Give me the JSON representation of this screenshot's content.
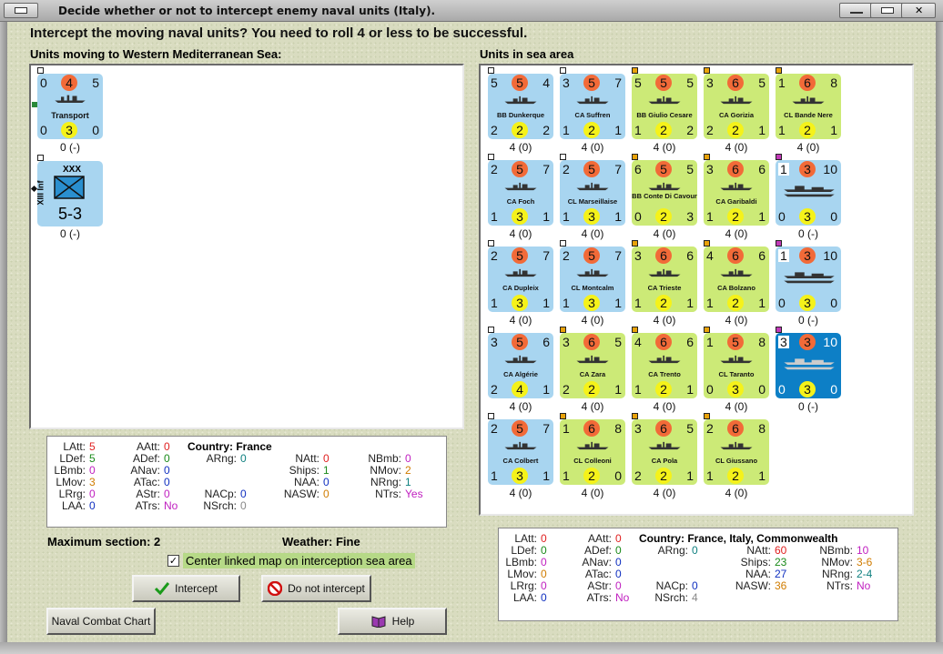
{
  "window": {
    "title": "Decide whether or not to intercept enemy naval units (Italy)."
  },
  "prompt": "Intercept the moving naval units?  You need to roll 4 or less to be successful.",
  "left_label": "Units moving to Western Mediterranean Sea:",
  "right_label": "Units in sea area",
  "moving_units": [
    {
      "name": "Transport",
      "top": "0",
      "att": "4",
      "tr": "5",
      "bl": "0",
      "def": "3",
      "br": "0",
      "caption": "0 (-)"
    },
    {
      "name": "XIII Inf",
      "size": "XXX",
      "strength": "5-3",
      "caption": "0 (-)"
    }
  ],
  "sea_units": [
    {
      "name": "BB Dunkerque",
      "tl": "5",
      "att": "5",
      "tr": "4",
      "bl": "2",
      "def": "2",
      "br": "2",
      "caption": "4 (0)",
      "nation": "fr"
    },
    {
      "name": "CA Suffren",
      "tl": "3",
      "att": "5",
      "tr": "7",
      "bl": "1",
      "def": "2",
      "br": "1",
      "caption": "4 (0)",
      "nation": "fr"
    },
    {
      "name": "BB Giulio Cesare",
      "tl": "5",
      "att": "5",
      "tr": "5",
      "bl": "1",
      "def": "2",
      "br": "2",
      "caption": "4 (0)",
      "nation": "it"
    },
    {
      "name": "CA Gorizia",
      "tl": "3",
      "att": "6",
      "tr": "5",
      "bl": "2",
      "def": "2",
      "br": "1",
      "caption": "4 (0)",
      "nation": "it"
    },
    {
      "name": "CL Bande Nere",
      "tl": "1",
      "att": "6",
      "tr": "8",
      "bl": "1",
      "def": "2",
      "br": "1",
      "caption": "4 (0)",
      "nation": "it"
    },
    {
      "name": "CA Foch",
      "tl": "2",
      "att": "5",
      "tr": "7",
      "bl": "1",
      "def": "3",
      "br": "1",
      "caption": "4 (0)",
      "nation": "fr"
    },
    {
      "name": "CL Marseillaise",
      "tl": "2",
      "att": "5",
      "tr": "7",
      "bl": "1",
      "def": "3",
      "br": "1",
      "caption": "4 (0)",
      "nation": "fr"
    },
    {
      "name": "BB Conte Di Cavour",
      "tl": "6",
      "att": "5",
      "tr": "5",
      "bl": "0",
      "def": "2",
      "br": "3",
      "caption": "4 (0)",
      "nation": "it"
    },
    {
      "name": "CA Garibaldi",
      "tl": "3",
      "att": "6",
      "tr": "6",
      "bl": "1",
      "def": "2",
      "br": "1",
      "caption": "4 (0)",
      "nation": "it"
    },
    {
      "name": "",
      "tl": "1",
      "att": "3",
      "tr": "10",
      "bl": "0",
      "def": "3",
      "br": "0",
      "caption": "0 (-)",
      "nation": "fr"
    },
    {
      "name": "CA Dupleix",
      "tl": "2",
      "att": "5",
      "tr": "7",
      "bl": "1",
      "def": "3",
      "br": "1",
      "caption": "4 (0)",
      "nation": "fr"
    },
    {
      "name": "CL Montcalm",
      "tl": "2",
      "att": "5",
      "tr": "7",
      "bl": "1",
      "def": "3",
      "br": "1",
      "caption": "4 (0)",
      "nation": "fr"
    },
    {
      "name": "CA Trieste",
      "tl": "3",
      "att": "6",
      "tr": "6",
      "bl": "1",
      "def": "2",
      "br": "1",
      "caption": "4 (0)",
      "nation": "it"
    },
    {
      "name": "CA Bolzano",
      "tl": "4",
      "att": "6",
      "tr": "6",
      "bl": "1",
      "def": "2",
      "br": "1",
      "caption": "4 (0)",
      "nation": "it"
    },
    {
      "name": "",
      "tl": "1",
      "att": "3",
      "tr": "10",
      "bl": "0",
      "def": "3",
      "br": "0",
      "caption": "0 (-)",
      "nation": "fr"
    },
    {
      "name": "CA Algérie",
      "tl": "3",
      "att": "5",
      "tr": "6",
      "bl": "2",
      "def": "4",
      "br": "1",
      "caption": "4 (0)",
      "nation": "fr"
    },
    {
      "name": "CA Zara",
      "tl": "3",
      "att": "6",
      "tr": "5",
      "bl": "2",
      "def": "2",
      "br": "1",
      "caption": "4 (0)",
      "nation": "it"
    },
    {
      "name": "CA Trento",
      "tl": "4",
      "att": "6",
      "tr": "6",
      "bl": "1",
      "def": "2",
      "br": "1",
      "caption": "4 (0)",
      "nation": "it"
    },
    {
      "name": "CL Taranto",
      "tl": "1",
      "att": "5",
      "tr": "8",
      "bl": "0",
      "def": "3",
      "br": "0",
      "caption": "4 (0)",
      "nation": "it"
    },
    {
      "name": "",
      "tl": "3",
      "att": "3",
      "tr": "10",
      "bl": "0",
      "def": "3",
      "br": "0",
      "caption": "0 (-)",
      "nation": "sel"
    },
    {
      "name": "CA Colbert",
      "tl": "2",
      "att": "5",
      "tr": "7",
      "bl": "1",
      "def": "3",
      "br": "1",
      "caption": "4 (0)",
      "nation": "fr"
    },
    {
      "name": "CL Colleoni",
      "tl": "1",
      "att": "6",
      "tr": "8",
      "bl": "1",
      "def": "2",
      "br": "0",
      "caption": "4 (0)",
      "nation": "it"
    },
    {
      "name": "CA Pola",
      "tl": "3",
      "att": "6",
      "tr": "5",
      "bl": "2",
      "def": "2",
      "br": "1",
      "caption": "4 (0)",
      "nation": "it"
    },
    {
      "name": "CL Giussano",
      "tl": "2",
      "att": "6",
      "tr": "8",
      "bl": "1",
      "def": "2",
      "br": "1",
      "caption": "4 (0)",
      "nation": "it"
    }
  ],
  "left_stats": {
    "LAtt": "5",
    "LDef": "5",
    "LBmb": "0",
    "LMov": "3",
    "LRrg": "0",
    "LAA": "0",
    "AAtt": "0",
    "ADef": "0",
    "ANav": "0",
    "ATac": "0",
    "AStr": "0",
    "ATrs": "No",
    "country_label": "Country: France",
    "ARng": "0",
    "NACp": "0",
    "NSrch": "0",
    "NAtt": "0",
    "Ships": "1",
    "NAA": "0",
    "NASW": "0",
    "NBmb": "0",
    "NMov": "2",
    "NRng": "1",
    "NTrs": "Yes"
  },
  "right_stats": {
    "LAtt": "0",
    "LDef": "0",
    "LBmb": "0",
    "LMov": "0",
    "LRrg": "0",
    "LAA": "0",
    "AAtt": "0",
    "ADef": "0",
    "ANav": "0",
    "ATac": "0",
    "AStr": "0",
    "ATrs": "No",
    "country_label": "Country: France, Italy, Commonwealth",
    "ARng": "0",
    "NACp": "0",
    "NSrch": "4",
    "NAtt": "60",
    "Ships": "23",
    "NAA": "27",
    "NASW": "36",
    "NBmb": "10",
    "NMov": "3-6",
    "NRng": "2-4",
    "NTrs": "No"
  },
  "maximum_section": "Maximum section: 2",
  "weather": "Weather:  Fine",
  "center_checkbox": "Center linked map on interception sea area",
  "buttons": {
    "intercept": "Intercept",
    "do_not": "Do not intercept",
    "chart": "Naval Combat Chart",
    "help": "Help"
  },
  "colors": {
    "france": "#a8d5f0",
    "italy": "#ccea77",
    "selected": "#0d7fc6",
    "attack": "#f26a38",
    "defense": "#f5f21a"
  }
}
